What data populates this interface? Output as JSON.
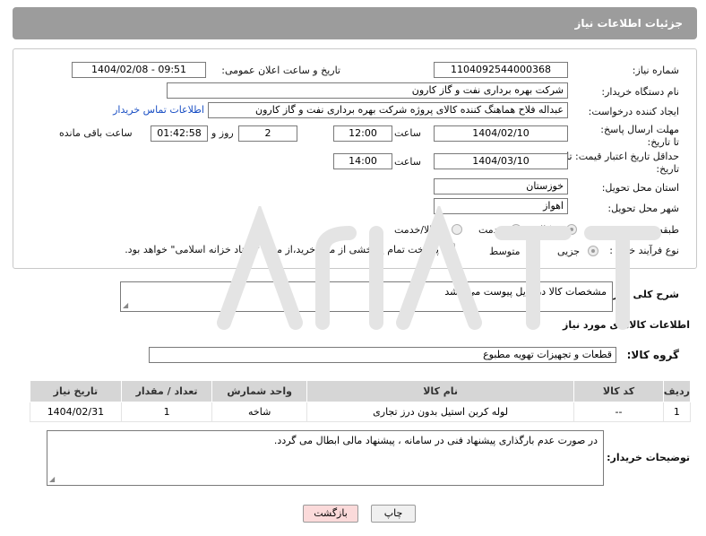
{
  "header": {
    "title": "جزئیات اطلاعات نیاز"
  },
  "form": {
    "need_number_label": "شماره نیاز:",
    "need_number": "1104092544000368",
    "announce_label": "تاریخ و ساعت اعلان عمومی:",
    "announce_value": "1404/02/08 - 09:51",
    "buyer_org_label": "نام دستگاه خریدار:",
    "buyer_org": "شرکت بهره برداری نفت و گاز کارون",
    "requester_label": "ایجاد کننده درخواست:",
    "requester": "عبداله فلاح هماهنگ کننده کالای پروژه شرکت بهره برداری نفت و گاز کارون",
    "buyer_contact_link": "اطلاعات تماس خریدار",
    "deadline_label": "مهلت ارسال پاسخ: تا تاریخ:",
    "deadline_date": "1404/02/10",
    "time_word": "ساعت",
    "deadline_time": "12:00",
    "days_value": "2",
    "days_word": "روز و",
    "remaining_time": "01:42:58",
    "remaining_word": "ساعت باقی مانده",
    "price_validity_label": "حداقل تاریخ اعتبار قیمت: تا تاریخ:",
    "price_validity_date": "1404/03/10",
    "price_validity_time": "14:00",
    "province_label": "استان محل تحویل:",
    "province": "خوزستان",
    "city_label": "شهر محل تحویل:",
    "city": "اهواز",
    "category_label": "طبقه بندی موضوعی:",
    "category_options": [
      "کالا",
      "خدمت",
      "کالا/خدمت"
    ],
    "process_label": "نوع فرآیند خرید :",
    "process_options": [
      "جزیی",
      "متوسط"
    ],
    "payment_note": "پرداخت تمام یا بخشی از مبلغ خرید،از محل \"اسناد خزانه اسلامی\" خواهد بود."
  },
  "description": {
    "label": "شرح کلی نیاز:",
    "value": "مشخصات کالا در فایل پیوست می باشد"
  },
  "goods": {
    "section_title": "اطلاعات کالاهای مورد نیاز",
    "group_label": "گروه کالا:",
    "group_value": "قطعات و تجهیزات تهویه مطبوع",
    "columns": [
      "ردیف",
      "کد کالا",
      "نام کالا",
      "واحد شمارش",
      "تعداد / مقدار",
      "تاریخ نیاز"
    ],
    "rows": [
      [
        "1",
        "--",
        "لوله کربن استیل بدون درز تجاری",
        "شاخه",
        "1",
        "1404/02/31"
      ]
    ]
  },
  "buyer_notes": {
    "label": "توضیحات خریدار:",
    "value": "در صورت عدم بارگذاری پیشنهاد فنی در سامانه ، پیشنهاد مالی ابطال می گردد."
  },
  "buttons": {
    "print": "چاپ",
    "back": "بازگشت"
  },
  "colors": {
    "header_bg": "#9c9c9c",
    "link": "#1a4fc4",
    "back_button_bg": "#fbdada",
    "watermark": "#e6e6e6"
  }
}
